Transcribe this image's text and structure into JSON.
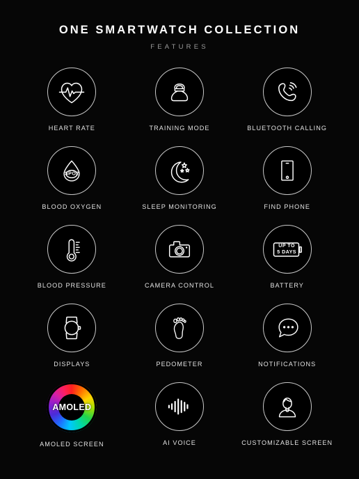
{
  "header": {
    "title": "ONE SMARTWATCH COLLECTION",
    "subtitle": "FEATURES"
  },
  "colors": {
    "background": "#060606",
    "stroke": "#ffffff",
    "circle_border": "#c9c9c9",
    "label": "#e2e2e2",
    "subtitle": "#9b9b9b",
    "amoled_ring": [
      "#ff2020",
      "#ff6a00",
      "#ffd400",
      "#a6e000",
      "#22d44a",
      "#00d8a8",
      "#00c8ff",
      "#1f6bff",
      "#4b2bd8",
      "#8a1fd0",
      "#d41fa8",
      "#ff1f5e"
    ]
  },
  "features": [
    {
      "label": "HEART RATE",
      "icon": "heart-rate-icon"
    },
    {
      "label": "TRAINING MODE",
      "icon": "kettlebell-icon"
    },
    {
      "label": "BLUETOOTH CALLING",
      "icon": "phone-call-icon"
    },
    {
      "label": "BLOOD OXYGEN",
      "icon": "droplet-spo2-icon",
      "inner_text": "SPO2"
    },
    {
      "label": "SLEEP MONITORING",
      "icon": "moon-stars-icon"
    },
    {
      "label": "FIND PHONE",
      "icon": "smartphone-icon"
    },
    {
      "label": "BLOOD PRESSURE",
      "icon": "thermometer-icon"
    },
    {
      "label": "CAMERA CONTROL",
      "icon": "camera-icon"
    },
    {
      "label": "BATTERY",
      "icon": "battery-icon",
      "inner_text_line1": "UP TO",
      "inner_text_line2": "5 DAYS"
    },
    {
      "label": "DISPLAYS",
      "icon": "smartwatch-icon"
    },
    {
      "label": "PEDOMETER",
      "icon": "footprint-icon"
    },
    {
      "label": "NOTIFICATIONS",
      "icon": "speech-bubble-icon"
    },
    {
      "label": "AMOLED SCREEN",
      "icon": "amoled-ring-icon",
      "inner_text": "AMOLED"
    },
    {
      "label": "AI VOICE",
      "icon": "waveform-icon"
    },
    {
      "label": "CUSTOMIZABLE SCREEN",
      "icon": "user-avatar-icon"
    }
  ]
}
